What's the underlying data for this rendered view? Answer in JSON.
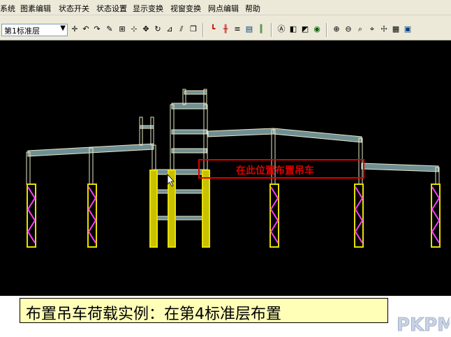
{
  "menu": [
    "系统",
    "图素编辑",
    "状态开关",
    "状态设置",
    "显示变换",
    "视窗变换",
    "网点编辑",
    "帮助"
  ],
  "toolbar": {
    "layer_value": "第1标准层",
    "icons": [
      "crosshair-icon",
      "undo-icon",
      "redo-icon",
      "pen-icon",
      "grid-icon",
      "snap-icon",
      "move-icon",
      "rotate-icon",
      "mirror-icon",
      "offset-icon",
      "copy-icon",
      "column-icon",
      "beam-icon",
      "stairs-icon",
      "chart-icon",
      "bars-icon",
      "circle-a-icon",
      "box3d-icon",
      "shade-icon",
      "eye-icon",
      "zoom-in-icon",
      "zoom-out-icon",
      "zoom-window-icon",
      "zoom-prev-icon",
      "pan-icon",
      "layers-icon"
    ]
  },
  "drawing": {
    "annotation": "在此位置布置吊车"
  },
  "caption": "布置吊车荷载实例：在第4标准层布置",
  "logo_text": "PKPM",
  "colors": {
    "canvas_bg": "#000000",
    "frame_stroke": "#e8e8c8",
    "beam_fill": "#6f8f93",
    "truss_outline": "#e8e000",
    "truss_brace": "#ff40ff",
    "annotation": "#e00000",
    "caption_bg": "#ffffb8"
  }
}
